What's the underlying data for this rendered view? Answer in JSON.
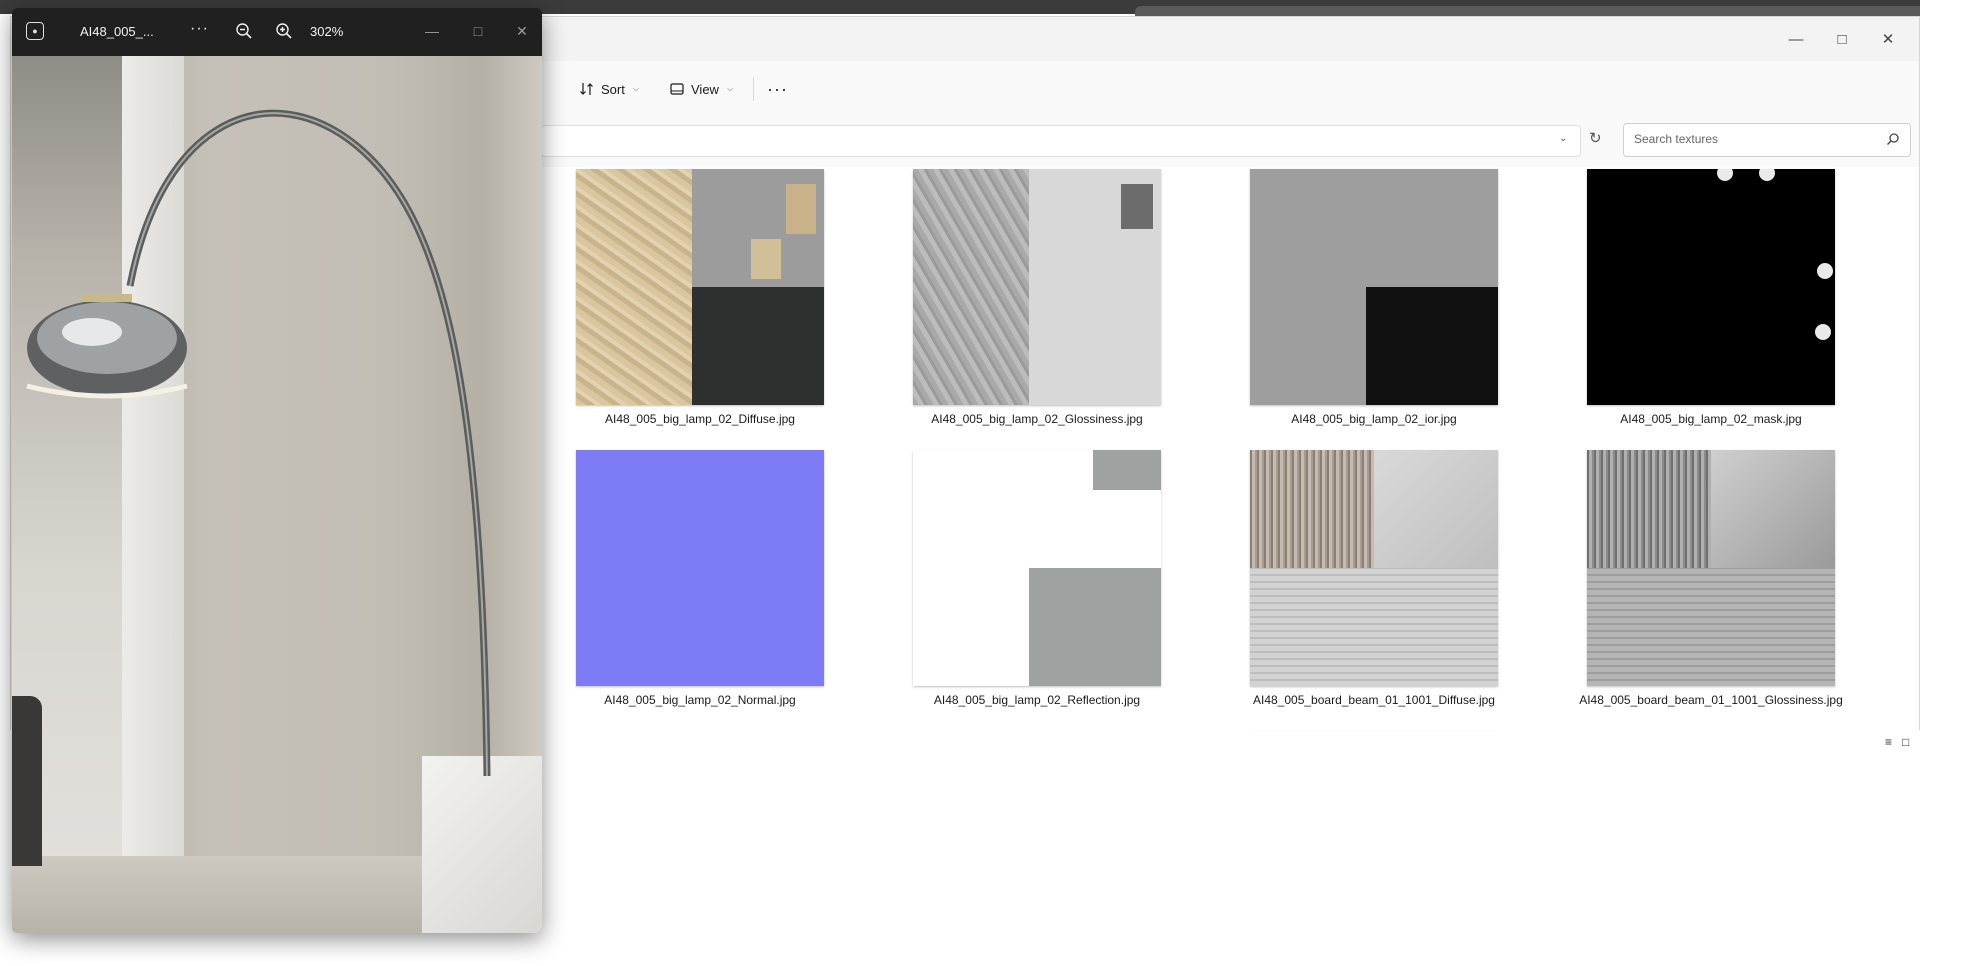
{
  "explorer": {
    "toolbar": {
      "sort_label": "Sort",
      "view_label": "View",
      "more_label": "···"
    },
    "search": {
      "placeholder": "Search textures"
    },
    "files": [
      {
        "name": "AI48_005_big_lamp_02_Diffuse.jpg"
      },
      {
        "name": "AI48_005_big_lamp_02_Glossiness.jpg"
      },
      {
        "name": "AI48_005_big_lamp_02_ior.jpg"
      },
      {
        "name": "AI48_005_big_lamp_02_mask.jpg"
      },
      {
        "name": "AI48_005_big_lamp_02_Normal.jpg"
      },
      {
        "name": "AI48_005_big_lamp_02_Reflection.jpg"
      },
      {
        "name": "AI48_005_board_beam_01_1001_Diffuse.jpg"
      },
      {
        "name": "AI48_005_board_beam_01_1001_Glossiness.jpg"
      }
    ]
  },
  "photos": {
    "title": "AI48_005_...",
    "more_label": "···",
    "zoom": "302%"
  },
  "icons": {
    "minimize": "minimize-icon",
    "maximize": "maximize-icon",
    "close": "close-icon",
    "search": "search-icon",
    "refresh": "refresh-icon",
    "zoom_in": "zoom-in-icon",
    "zoom_out": "zoom-out-icon",
    "sort": "sort-icon",
    "view": "view-icon"
  }
}
